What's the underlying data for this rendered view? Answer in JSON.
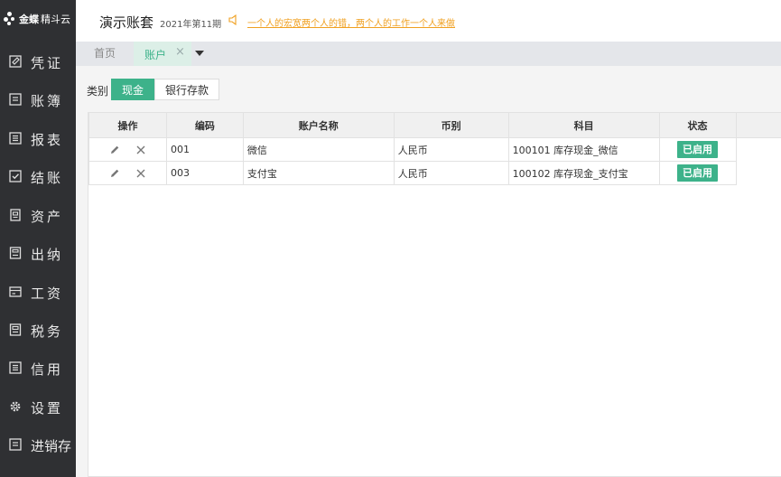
{
  "brand": {
    "logo_text": "金蝶",
    "product": "精斗云"
  },
  "sidebar": {
    "items": [
      {
        "label": "凭证",
        "icon": "voucher-icon"
      },
      {
        "label": "账簿",
        "icon": "ledger-icon"
      },
      {
        "label": "报表",
        "icon": "report-icon"
      },
      {
        "label": "结账",
        "icon": "checkout-icon"
      },
      {
        "label": "资产",
        "icon": "asset-icon"
      },
      {
        "label": "出纳",
        "icon": "cashier-icon"
      },
      {
        "label": "工资",
        "icon": "salary-icon"
      },
      {
        "label": "税务",
        "icon": "tax-icon"
      },
      {
        "label": "信用",
        "icon": "credit-icon"
      },
      {
        "label": "设置",
        "icon": "gear-icon"
      },
      {
        "label": "进销存",
        "icon": "inventory-icon"
      }
    ]
  },
  "header": {
    "title": "演示账套",
    "period": "2021年第11期",
    "notice": "一个人的宏宽两个人的错，两个人的工作一个人来做"
  },
  "tabs": {
    "home": "首页",
    "active": "账户",
    "close": "×"
  },
  "filter": {
    "label": "类别",
    "options": [
      "现金",
      "银行存款"
    ],
    "selected": "现金"
  },
  "table": {
    "columns": [
      "操作",
      "编码",
      "账户名称",
      "币别",
      "科目",
      "状态"
    ],
    "rows": [
      {
        "code": "001",
        "name": "微信",
        "currency": "人民币",
        "subject": "100101 库存现金_微信",
        "status": "已启用"
      },
      {
        "code": "003",
        "name": "支付宝",
        "currency": "人民币",
        "subject": "100102 库存现金_支付宝",
        "status": "已启用"
      }
    ]
  },
  "colors": {
    "accent": "#3db28a",
    "sidebar_bg": "#2f3033",
    "notice": "#f0a020"
  }
}
